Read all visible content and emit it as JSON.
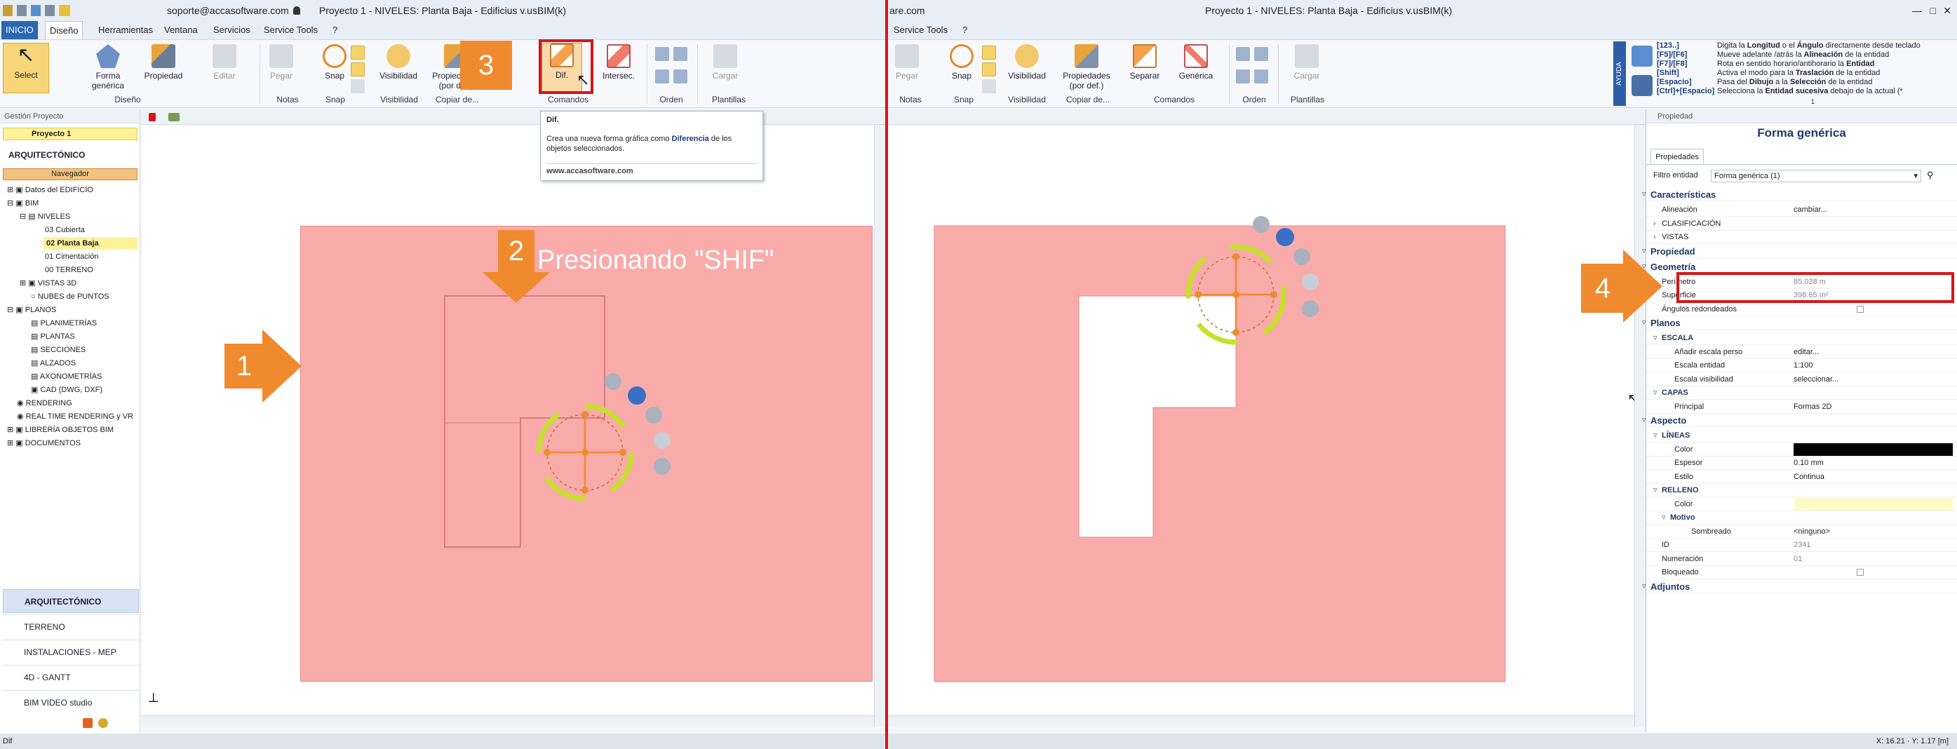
{
  "left": {
    "title": "Proyecto 1 - NIVELES: Planta Baja - Edificius v.usBIM(k)",
    "user": "soporte@accasoftware.com",
    "tabs": [
      "INICIO",
      "Diseño",
      "Herramientas",
      "Ventana",
      "Servicios",
      "Service Tools",
      "?"
    ],
    "ribbon": {
      "select": "Select",
      "forma_generica": "Forma genérica",
      "propiedad": "Propiedad",
      "editar": "Editar",
      "pegar": "Pegar",
      "snap": "Snap",
      "visibilidad": "Visibilidad",
      "propiedades": "Propiedades (por def.)",
      "dif": "Dif.",
      "intersec": "Intersec.",
      "cargar": "Cargar",
      "groups": [
        "Diseño",
        "Notas",
        "Snap",
        "Visibilidad",
        "Copiar de...",
        "Comandos",
        "Orden",
        "Plantillas"
      ]
    },
    "tooltip": {
      "title": "Dif.",
      "text_pre": "Crea una nueva forma gráfica como ",
      "text_bold": "Diferencia",
      "text_post": " de los objetos seleccionados.",
      "url": "www.accasoftware.com"
    },
    "tree": {
      "header": "Gestión Proyecto",
      "project": "Proyecto 1",
      "section": "ARQUITECTÓNICO",
      "navigator": "Navegador",
      "items": [
        "Datos del EDIFICIO",
        "BIM",
        "NIVELES",
        "03 Cubierta",
        "02 Planta Baja",
        "01 Cimentación",
        "00 TERRENO",
        "VISTAS 3D",
        "NUBES de PUNTOS",
        "PLANOS",
        "PLANIMETRÍAS",
        "PLANTAS",
        "SECCIONES",
        "ALZADOS",
        "AXONOMETRÍAS",
        "CAD (DWG, DXF)",
        "RENDERING",
        "REAL TIME RENDERING y VR",
        "LIBRERÍA OBJETOS BIM",
        "DOCUMENTOS"
      ]
    },
    "bottom_nav": [
      "ARQUITECTÓNICO",
      "TERRENO",
      "INSTALACIONES - MEP",
      "4D - GANTT",
      "BIM VIDEO studio"
    ],
    "callouts": {
      "one": "1",
      "two": "2",
      "shift_text": "Presionando \"SHIF\"",
      "three": "3"
    },
    "status": "Dif"
  },
  "right": {
    "title": "Proyecto 1 - NIVELES: Planta Baja - Edificius v.usBIM(k)",
    "user_fragment": "are.com",
    "tabs": [
      "Service Tools",
      "?"
    ],
    "ribbon": {
      "pegar": "Pegar",
      "snap": "Snap",
      "visibilidad": "Visibilidad",
      "propiedades": "Propiedades (por def.)",
      "separar": "Separar",
      "generica": "Genérica",
      "cargar": "Cargar",
      "groups": [
        "Notas",
        "Snap",
        "Visibilidad",
        "Copiar de...",
        "Comandos",
        "Orden",
        "Plantillas"
      ]
    },
    "ayuda": "AYUDA",
    "hotkeys": [
      {
        "key": "[123..]",
        "pre": "Digita la ",
        "b1": "Longitud",
        "mid": " o el ",
        "b2": "Ángulo",
        "post": " directamente desde teclado"
      },
      {
        "key": "[F5]/[F6]",
        "pre": "Mueve adelante /atrás la ",
        "b1": "Alineación",
        "mid": " de la entidad",
        "b2": "",
        "post": ""
      },
      {
        "key": "[F7]/[F8]",
        "pre": "Rota en sentido horario/antihorario la ",
        "b1": "Entidad",
        "mid": "",
        "b2": "",
        "post": ""
      },
      {
        "key": "[Shift]",
        "pre": "Activa el modo para la ",
        "b1": "Traslación",
        "mid": " de la entidad",
        "b2": "",
        "post": ""
      },
      {
        "key": "[Espacio]",
        "pre": "Pasa del ",
        "b1": "Dibujo",
        "mid": " a la ",
        "b2": "Selección",
        "post": " de la entidad"
      },
      {
        "key": "[Ctrl]+[Espacio]",
        "pre": "Selecciona la ",
        "b1": "Entidad sucesiva",
        "mid": " debajo de la actual (*",
        "b2": "",
        "post": ""
      }
    ],
    "hotkeys_page": "1",
    "callouts": {
      "four": "4"
    },
    "status": "X: 16.21 · Y: 1.17 [m]",
    "props": {
      "header": "Propiedad",
      "title": "Forma genérica",
      "tab": "Propiedades",
      "filter_label": "Filtro entidad",
      "filter_value": "Forma genérica (1)",
      "rows": [
        {
          "type": "section",
          "label": "Características",
          "value": ""
        },
        {
          "type": "prop",
          "label": "Alineación",
          "value": "cambiar..."
        },
        {
          "type": "sub",
          "label": "CLASIFICACIÓN",
          "value": ""
        },
        {
          "type": "sub",
          "label": "VISTAS",
          "value": ""
        },
        {
          "type": "section",
          "label": "Propiedad",
          "value": ""
        },
        {
          "type": "section",
          "label": "Geometría",
          "value": ""
        },
        {
          "type": "prop",
          "label": "Perímetro",
          "value": "85.028 m"
        },
        {
          "type": "prop",
          "label": "Superficie",
          "value": "398.65 m²"
        },
        {
          "type": "prop",
          "label": "Ángulos redondeados",
          "value": ""
        },
        {
          "type": "section",
          "label": "Planos",
          "value": ""
        },
        {
          "type": "subhead",
          "label": "ESCALA",
          "value": ""
        },
        {
          "type": "prop2",
          "label": "Añadir escala perso",
          "value": "editar..."
        },
        {
          "type": "prop2",
          "label": "Escala entidad",
          "value": "1:100"
        },
        {
          "type": "prop2",
          "label": "Escala visibilidad",
          "value": "seleccionar..."
        },
        {
          "type": "subhead",
          "label": "CAPAS",
          "value": ""
        },
        {
          "type": "prop2",
          "label": "Principal",
          "value": "Formas 2D"
        },
        {
          "type": "section",
          "label": "Aspecto",
          "value": ""
        },
        {
          "type": "subhead",
          "label": "LÍNEAS",
          "value": ""
        },
        {
          "type": "prop2",
          "label": "Color",
          "value": ""
        },
        {
          "type": "prop2",
          "label": "Espesor",
          "value": "0.10 mm"
        },
        {
          "type": "prop2",
          "label": "Estilo",
          "value": "Continua"
        },
        {
          "type": "subhead",
          "label": "RELLENO",
          "value": ""
        },
        {
          "type": "prop2",
          "label": "Color",
          "value": ""
        },
        {
          "type": "subhead2",
          "label": "Motivo",
          "value": ""
        },
        {
          "type": "prop3",
          "label": "Sombreado",
          "value": "<ninguno>"
        },
        {
          "type": "prop",
          "label": "ID",
          "value": "2341"
        },
        {
          "type": "prop",
          "label": "Numeración",
          "value": "01"
        },
        {
          "type": "prop",
          "label": "Bloqueado",
          "value": ""
        },
        {
          "type": "section",
          "label": "Adjuntos",
          "value": ""
        }
      ]
    }
  },
  "colors": {
    "accent_red": "#d7141a",
    "callout_orange": "#f08a2e",
    "shape_fill": "#f9abaa",
    "gizmo_green": "#c6e12a",
    "gizmo_orange": "#f08a2e"
  }
}
